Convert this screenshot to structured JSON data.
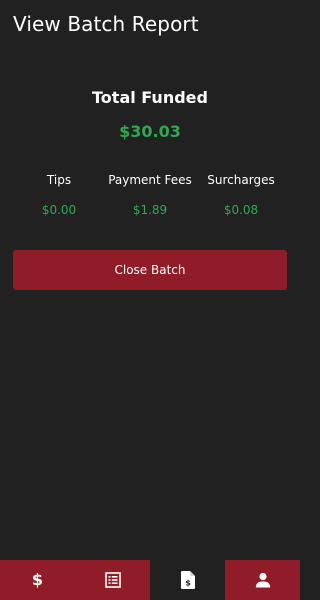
{
  "header": {
    "title": "View Batch Report"
  },
  "summary": {
    "total_label": "Total Funded",
    "total_value": "$30.03"
  },
  "stats": [
    {
      "label": "Tips",
      "value": "$0.00"
    },
    {
      "label": "Payment Fees",
      "value": "$1.89"
    },
    {
      "label": "Surcharges",
      "value": "$0.08"
    }
  ],
  "actions": {
    "close_batch_label": "Close Batch"
  },
  "nav": {
    "tabs": [
      {
        "icon": "dollar-icon",
        "active": false
      },
      {
        "icon": "list-icon",
        "active": false
      },
      {
        "icon": "invoice-icon",
        "active": true
      },
      {
        "icon": "user-icon",
        "active": false
      }
    ],
    "dollar_glyph": "$"
  },
  "colors": {
    "background": "#212121",
    "accent": "#8f1c26",
    "money_green": "#2fa84f",
    "text": "#ffffff"
  }
}
